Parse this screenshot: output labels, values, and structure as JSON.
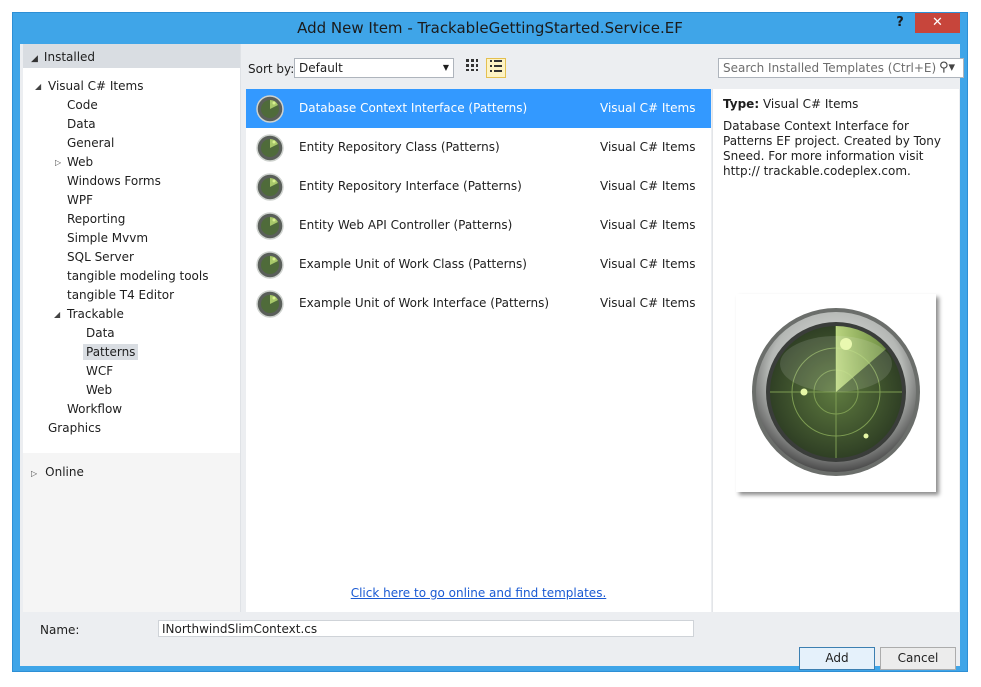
{
  "window": {
    "title": "Add New Item - TrackableGettingStarted.Service.EF",
    "help_glyph": "?",
    "close_glyph": "✕"
  },
  "tree": {
    "header": "Installed",
    "items": [
      {
        "label": "Visual C# Items"
      },
      {
        "label": "Code"
      },
      {
        "label": "Data"
      },
      {
        "label": "General"
      },
      {
        "label": "Web"
      },
      {
        "label": "Windows Forms"
      },
      {
        "label": "WPF"
      },
      {
        "label": "Reporting"
      },
      {
        "label": "Simple Mvvm"
      },
      {
        "label": "SQL Server"
      },
      {
        "label": "tangible modeling tools"
      },
      {
        "label": "tangible T4 Editor"
      },
      {
        "label": "Trackable"
      },
      {
        "label": "Data"
      },
      {
        "label": "Patterns"
      },
      {
        "label": "WCF"
      },
      {
        "label": "Web"
      },
      {
        "label": "Workflow"
      },
      {
        "label": "Graphics"
      }
    ],
    "online": "Online"
  },
  "toolbar": {
    "sort_label": "Sort by:",
    "sort_value": "Default",
    "search_placeholder": "Search Installed Templates (Ctrl+E)"
  },
  "templates": [
    {
      "name": "Database Context Interface (Patterns)",
      "category": "Visual C# Items"
    },
    {
      "name": "Entity Repository Class (Patterns)",
      "category": "Visual C# Items"
    },
    {
      "name": "Entity Repository Interface (Patterns)",
      "category": "Visual C# Items"
    },
    {
      "name": "Entity Web API Controller (Patterns)",
      "category": "Visual C# Items"
    },
    {
      "name": "Example Unit of Work Class (Patterns)",
      "category": "Visual C# Items"
    },
    {
      "name": "Example Unit of Work Interface (Patterns)",
      "category": "Visual C# Items"
    }
  ],
  "online_link": "Click here to go online and find templates.",
  "detail": {
    "type_label": "Type:",
    "type_value": "Visual C# Items",
    "description": "Database Context Interface for Patterns EF project. Created by Tony Sneed. For more information visit http:// trackable.codeplex.com."
  },
  "footer": {
    "name_label": "Name:",
    "name_value": "INorthwindSlimContext.cs",
    "add_label": "Add",
    "cancel_label": "Cancel"
  },
  "colors": {
    "title_bar": "#3fa5e8",
    "selection": "#3399ff",
    "close_button": "#c7453b",
    "link": "#1a5ad3"
  }
}
